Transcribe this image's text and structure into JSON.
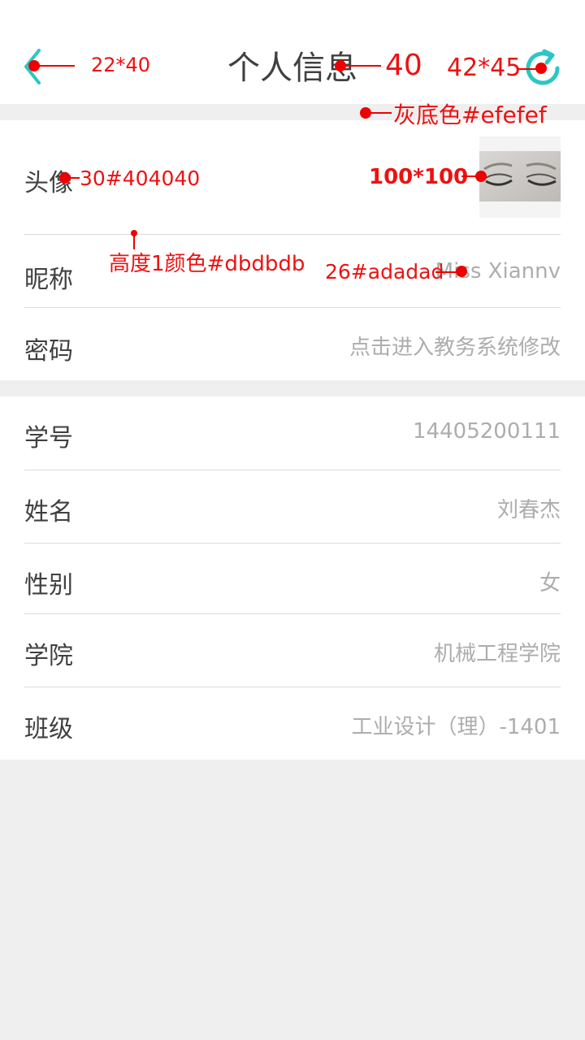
{
  "header": {
    "title": "个人信息",
    "back_icon": "arrow-left-icon",
    "refresh_icon": "refresh-icon",
    "accent_color": "#2cc6c6"
  },
  "colors": {
    "page_bg": "#efefef",
    "label": "#404040",
    "value": "#adadad",
    "divider": "#dbdbdb",
    "annotation": "#ee0000"
  },
  "profile": {
    "avatar": {
      "label": "头像"
    },
    "nickname": {
      "label": "昵称",
      "value": "Miss Xiannv"
    },
    "password": {
      "label": "密码",
      "value": "点击进入教务系统修改"
    }
  },
  "student": {
    "student_id": {
      "label": "学号",
      "value": "14405200111"
    },
    "name": {
      "label": "姓名",
      "value": "刘春杰"
    },
    "gender": {
      "label": "性别",
      "value": "女"
    },
    "college": {
      "label": "学院",
      "value": "机械工程学院"
    },
    "class": {
      "label": "班级",
      "value": "工业设计（理）-1401"
    }
  },
  "annotations": {
    "back_size": "22*40",
    "title_size": "40",
    "refresh_size": "42*45",
    "gray_bg": "灰底色#efefef",
    "label_spec": "30#404040",
    "avatar_size": "100*100",
    "divider_spec": "高度1颜色#dbdbdb",
    "value_spec": "26#adadad"
  }
}
